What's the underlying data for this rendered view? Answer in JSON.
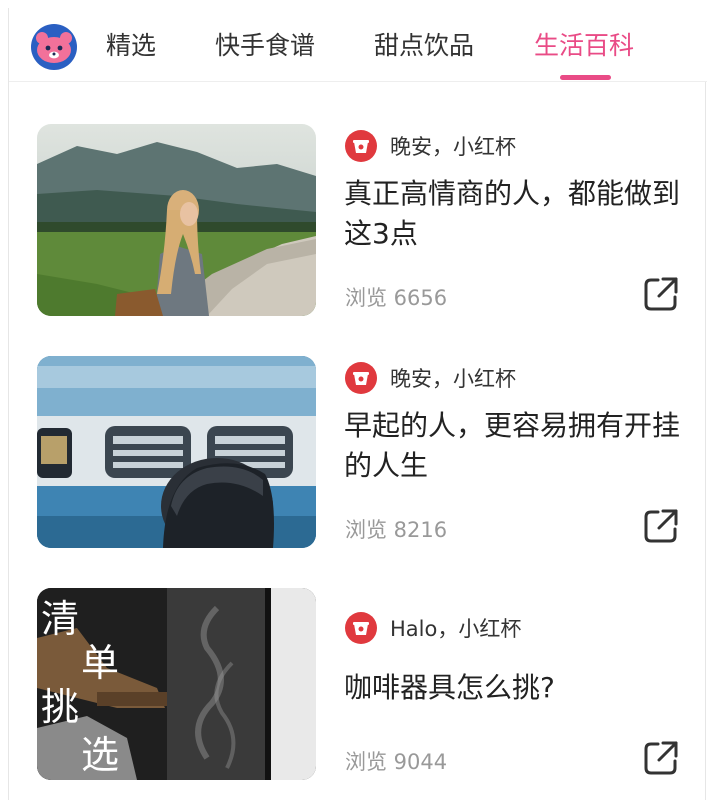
{
  "tabs": [
    {
      "label": "精选"
    },
    {
      "label": "快手食谱"
    },
    {
      "label": "甜点饮品"
    },
    {
      "label": "生活百科"
    }
  ],
  "active_tab": 3,
  "colors": {
    "accent": "#e94b86",
    "avatar_red": "#e0393e",
    "logo_bg": "#2a5fc2",
    "logo_bear": "#f2719a"
  },
  "articles": [
    {
      "author": "晚安，小红杯",
      "title": "真正高情商的人，都能做到这3点",
      "views": "浏览 6656",
      "image": "woman-on-country-road",
      "share_icon": "share-icon"
    },
    {
      "author": "晚安，小红杯",
      "title": "早起的人，更容易拥有开挂的人生",
      "views": "浏览 8216",
      "image": "man-by-moving-train",
      "share_icon": "share-icon"
    },
    {
      "author": "Halo，小红杯",
      "title": "咖啡器具怎么挑?",
      "views": "浏览 9044",
      "image": "coffee-pot-steam",
      "image_text": [
        "清",
        "单",
        "挑",
        "选"
      ],
      "share_icon": "share-icon"
    }
  ]
}
